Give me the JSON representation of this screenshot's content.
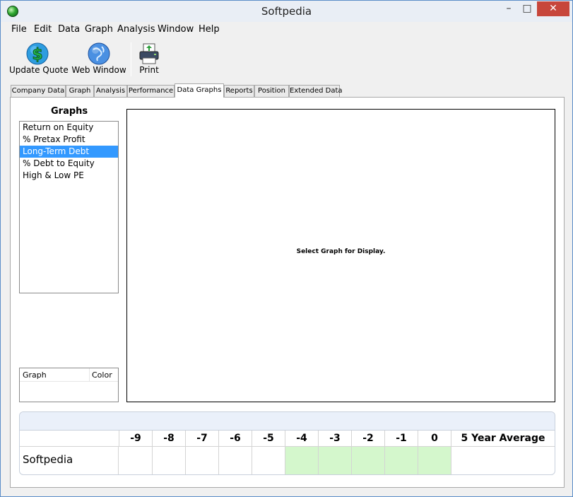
{
  "window": {
    "title": "Softpedia"
  },
  "menu": [
    "File",
    "Edit",
    "Data",
    "Graph",
    "Analysis",
    "Window",
    "Help"
  ],
  "toolbar": {
    "update_quote": "Update Quote",
    "web_window": "Web Window",
    "print": "Print"
  },
  "tabs": [
    "Company Data",
    "Graph",
    "Analysis",
    "Performance",
    "Data Graphs",
    "Reports",
    "Position",
    "Extended Data"
  ],
  "active_tab": "Data Graphs",
  "graphs_panel": {
    "title": "Graphs",
    "items": [
      "Return on Equity",
      "% Pretax Profit",
      "Long-Term Debt",
      "% Debt to Equity",
      "High & Low PE"
    ],
    "selected": "Long-Term Debt"
  },
  "legend": {
    "col_graph": "Graph",
    "col_color": "Color"
  },
  "graph_area": {
    "message": "Select Graph for Display."
  },
  "data_table": {
    "columns": [
      "-9",
      "-8",
      "-7",
      "-6",
      "-5",
      "-4",
      "-3",
      "-2",
      "-1",
      "0",
      "5 Year Average"
    ],
    "row_label": "Softpedia",
    "highlight_color": "#d4f7cc"
  }
}
